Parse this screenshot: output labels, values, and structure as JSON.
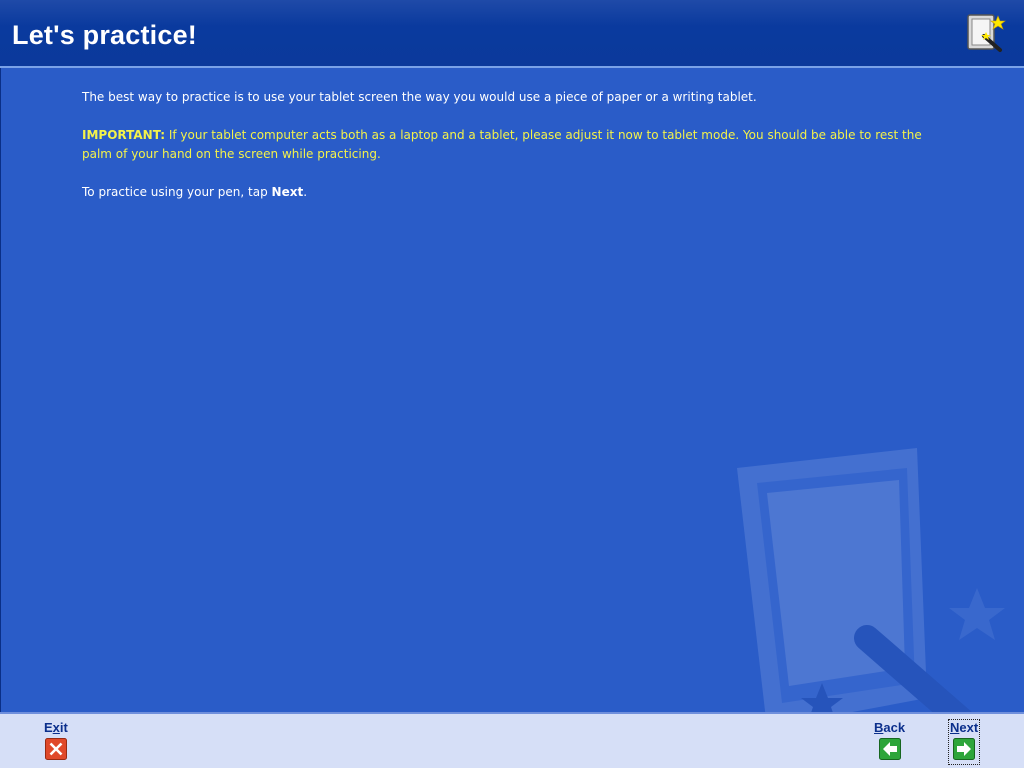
{
  "header": {
    "title": "Let's practice!",
    "icon": "tablet-pen-wizard-icon"
  },
  "content": {
    "paragraph1": "The best way to practice is to use your tablet screen the way you would use a piece of paper or a writing tablet.",
    "important_label": "IMPORTANT:",
    "important_text": " If your tablet computer acts both as a laptop and a tablet, please adjust it now to tablet mode. You should be able to rest the palm of your hand on the screen while practicing.",
    "paragraph3_prefix": "To practice using your pen, tap ",
    "paragraph3_bold": "Next",
    "paragraph3_suffix": "."
  },
  "footer": {
    "exit": {
      "prefix": "E",
      "accel": "x",
      "suffix": "it",
      "icon": "close-x-icon"
    },
    "back": {
      "prefix": "",
      "accel": "B",
      "suffix": "ack",
      "icon": "arrow-left-icon"
    },
    "next": {
      "prefix": "",
      "accel": "N",
      "suffix": "ext",
      "icon": "arrow-right-icon"
    }
  },
  "colors": {
    "header_bg": "#0b399b",
    "body_bg": "#2a5cc8",
    "important_text": "#f4f24a",
    "footer_bg": "#d6dff7",
    "link": "#0b2f8c"
  }
}
